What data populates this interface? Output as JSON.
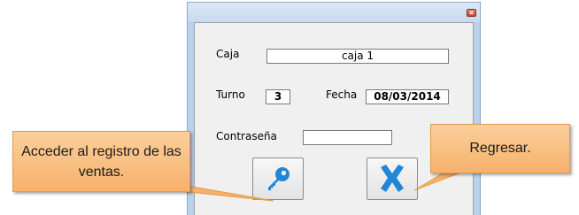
{
  "form": {
    "caja_label": "Caja",
    "caja_value": "caja 1",
    "turno_label": "Turno",
    "turno_value": "3",
    "fecha_label": "Fecha",
    "fecha_value": "08/03/2014",
    "contrasena_label": "Contraseña",
    "contrasena_value": ""
  },
  "buttons": {
    "access_icon": "key-icon",
    "cancel_icon": "x-icon"
  },
  "callouts": {
    "access": "Acceder al registro de las ventas.",
    "back": "Regresar."
  },
  "colors": {
    "callout_fill": "#f9be80",
    "dialog_frame": "#b9d1ea",
    "icon_blue": "#1f86d8"
  }
}
